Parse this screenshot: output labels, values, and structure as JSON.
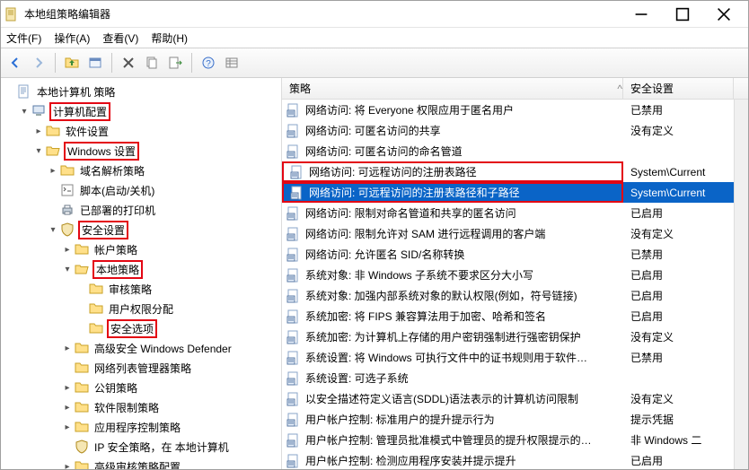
{
  "window": {
    "title": "本地组策略编辑器"
  },
  "menu": {
    "file": "文件(F)",
    "action": "操作(A)",
    "view": "查看(V)",
    "help": "帮助(H)"
  },
  "toolbar_tips": {
    "back": "后退",
    "forward": "前进",
    "up": "上一级",
    "folder": "打开",
    "properties": "属性",
    "delete": "删除",
    "copy": "复制",
    "paste": "粘贴",
    "help": "帮助",
    "refresh": "刷新",
    "list": "列表"
  },
  "tree": {
    "root": "本地计算机 策略",
    "computer": "计算机配置",
    "software_settings": "软件设置",
    "windows_settings": "Windows 设置",
    "name_res": "域名解析策略",
    "scripts": "脚本(启动/关机)",
    "printers": "已部署的打印机",
    "security": "安全设置",
    "account": "帐户策略",
    "local_pol": "本地策略",
    "audit": "审核策略",
    "user_rights": "用户权限分配",
    "sec_options": "安全选项",
    "defender": "高级安全 Windows Defender",
    "nlm": "网络列表管理器策略",
    "pk": "公钥策略",
    "srp": "软件限制策略",
    "acp": "应用程序控制策略",
    "ipsec": "IP 安全策略，在 本地计算机",
    "advaudit": "高级审核策略配置"
  },
  "list": {
    "col_policy": "策略",
    "col_setting": "安全设置",
    "rows": [
      {
        "name": "网络访问: 将 Everyone 权限应用于匿名用户",
        "setting": "已禁用",
        "hl": false,
        "sel": false
      },
      {
        "name": "网络访问: 可匿名访问的共享",
        "setting": "没有定义",
        "hl": false,
        "sel": false
      },
      {
        "name": "网络访问: 可匿名访问的命名管道",
        "setting": "",
        "hl": false,
        "sel": false
      },
      {
        "name": "网络访问: 可远程访问的注册表路径",
        "setting": "System\\Current",
        "hl": true,
        "sel": false
      },
      {
        "name": "网络访问: 可远程访问的注册表路径和子路径",
        "setting": "System\\Current",
        "hl": true,
        "sel": true
      },
      {
        "name": "网络访问: 限制对命名管道和共享的匿名访问",
        "setting": "已启用",
        "hl": false,
        "sel": false
      },
      {
        "name": "网络访问: 限制允许对 SAM 进行远程调用的客户端",
        "setting": "没有定义",
        "hl": false,
        "sel": false
      },
      {
        "name": "网络访问: 允许匿名 SID/名称转换",
        "setting": "已禁用",
        "hl": false,
        "sel": false
      },
      {
        "name": "系统对象: 非 Windows 子系统不要求区分大小写",
        "setting": "已启用",
        "hl": false,
        "sel": false
      },
      {
        "name": "系统对象: 加强内部系统对象的默认权限(例如，符号链接)",
        "setting": "已启用",
        "hl": false,
        "sel": false
      },
      {
        "name": "系统加密: 将 FIPS 兼容算法用于加密、哈希和签名",
        "setting": "已启用",
        "hl": false,
        "sel": false
      },
      {
        "name": "系统加密: 为计算机上存储的用户密钥强制进行强密钥保护",
        "setting": "没有定义",
        "hl": false,
        "sel": false
      },
      {
        "name": "系统设置: 将 Windows 可执行文件中的证书规则用于软件…",
        "setting": "已禁用",
        "hl": false,
        "sel": false
      },
      {
        "name": "系统设置: 可选子系统",
        "setting": "",
        "hl": false,
        "sel": false
      },
      {
        "name": "以安全描述符定义语言(SDDL)语法表示的计算机访问限制",
        "setting": "没有定义",
        "hl": false,
        "sel": false
      },
      {
        "name": "用户帐户控制: 标准用户的提升提示行为",
        "setting": "提示凭据",
        "hl": false,
        "sel": false
      },
      {
        "name": "用户帐户控制: 管理员批准模式中管理员的提升权限提示的…",
        "setting": "非 Windows 二",
        "hl": false,
        "sel": false
      },
      {
        "name": "用户帐户控制: 检测应用程序安装并提示提升",
        "setting": "已启用",
        "hl": false,
        "sel": false
      }
    ]
  }
}
